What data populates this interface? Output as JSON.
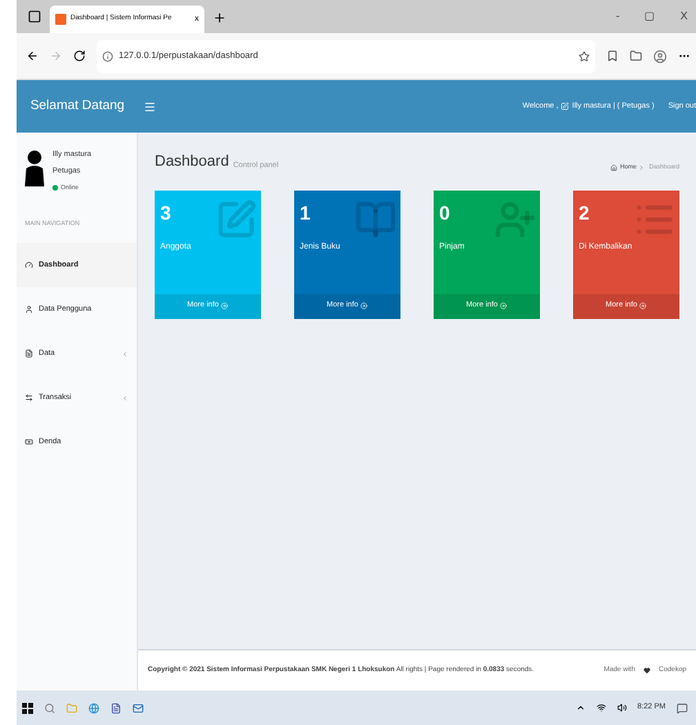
{
  "browser": {
    "tab_title": "Dashboard | Sistem Informasi Pe",
    "url": "127.0.0.1/perpustakaan/dashboard",
    "tab_close": "x",
    "window_controls": [
      "-",
      "▢",
      "X"
    ]
  },
  "header": {
    "brand": "Selamat Datang",
    "welcome": "Welcome ,",
    "user": "Illy mastura | ( Petugas )",
    "signout": "Sign out"
  },
  "sidebar": {
    "user_name": "Illy mastura",
    "user_role": "Petugas",
    "status": "Online",
    "section": "MAIN NAVIGATION",
    "items": [
      {
        "label": "Dashboard",
        "kind": "dashboard",
        "selected": true,
        "expandable": false
      },
      {
        "label": "Data Pengguna",
        "kind": "user",
        "selected": false,
        "expandable": false
      },
      {
        "label": "Data",
        "kind": "data",
        "selected": false,
        "expandable": true
      },
      {
        "label": "Transaksi",
        "kind": "exchange",
        "selected": false,
        "expandable": true
      },
      {
        "label": "Denda",
        "kind": "money",
        "selected": false,
        "expandable": false
      }
    ]
  },
  "page": {
    "title": "Dashboard",
    "subtitle": "Control panel",
    "breadcrumb": [
      "Home",
      "Dashboard"
    ]
  },
  "cards": [
    {
      "count": "3",
      "label": "Anggota",
      "color": "#00c0ef",
      "kind": "edit",
      "link": "More info"
    },
    {
      "count": "1",
      "label": "Jenis Buku",
      "color": "#0073b7",
      "kind": "book",
      "link": "More info"
    },
    {
      "count": "0",
      "label": "Pinjam",
      "color": "#00a65a",
      "kind": "user-add",
      "link": "More info"
    },
    {
      "count": "2",
      "label": "Di Kembalikan",
      "color": "#dd4b39",
      "kind": "list",
      "link": "More info"
    }
  ],
  "footer": {
    "copyright": "**Copyright © 2021 Sistem Informasi Perpustakaan SMK Negeri 1 Lhoksukon** All rights | Page rendered in **0.0833** seconds.",
    "made_with": "Made with",
    "brand": "Codekop"
  },
  "taskbar": {
    "time": "8:22 PM"
  }
}
